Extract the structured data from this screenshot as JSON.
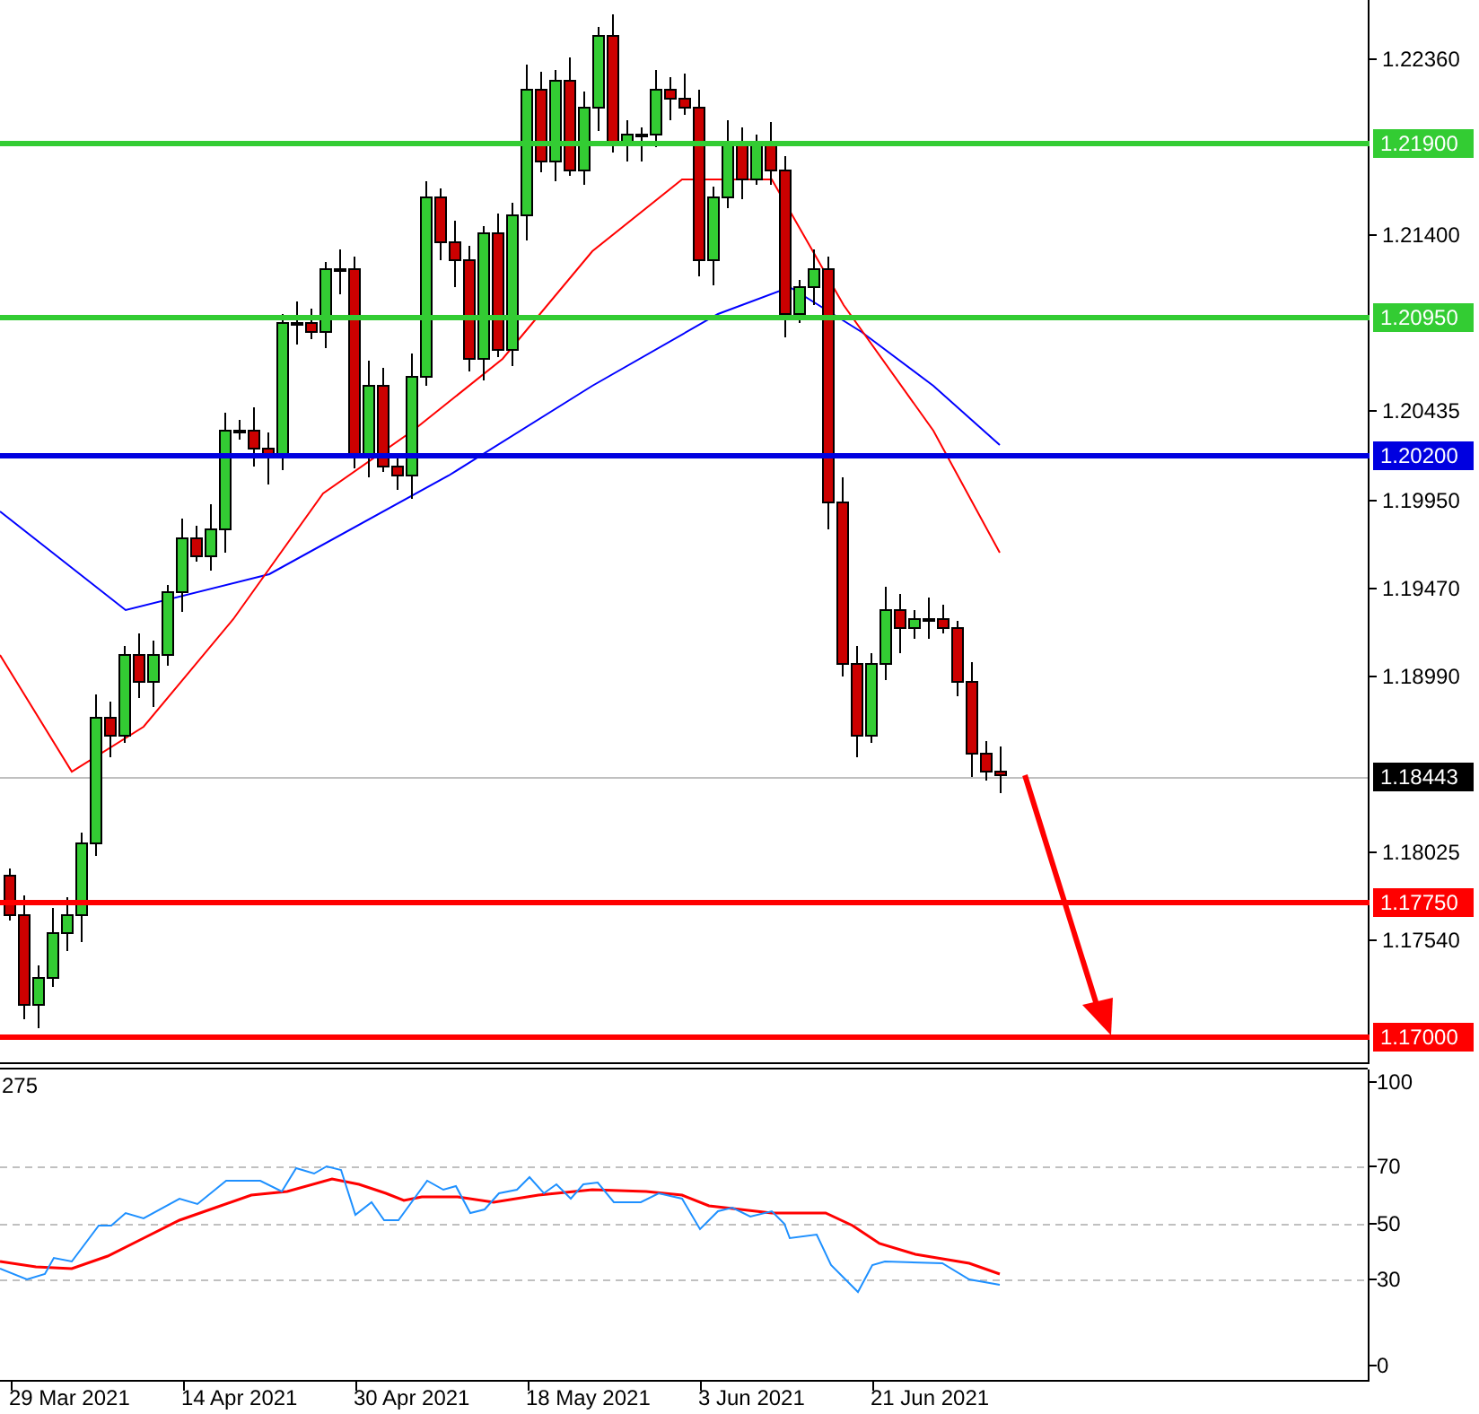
{
  "main_chart": {
    "price_ticks": [
      "1.22360",
      "1.21400",
      "1.20435",
      "1.19950",
      "1.19470",
      "1.18990",
      "1.18025",
      "1.17540"
    ],
    "levels": [
      {
        "label": "1.21900",
        "color": "#33cc33"
      },
      {
        "label": "1.20950",
        "color": "#33cc33"
      },
      {
        "label": "1.20200",
        "color": "#0000e0"
      },
      {
        "label": "1.17750",
        "color": "#ff0000"
      },
      {
        "label": "1.17000",
        "color": "#ff0000"
      }
    ],
    "current_price": "1.18443"
  },
  "oscillator": {
    "label": "275",
    "ticks": [
      "100",
      "70",
      "50",
      "30",
      "0"
    ]
  },
  "time_axis": {
    "labels": [
      "29 Mar 2021",
      "14 Apr 2021",
      "30 Apr 2021",
      "18 May 2021",
      "3 Jun 2021",
      "21 Jun 2021"
    ]
  }
}
